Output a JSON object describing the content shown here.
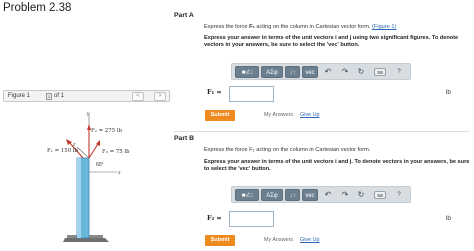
{
  "problem": {
    "title": "Problem 2.38"
  },
  "figure": {
    "label": "Figure 1",
    "current": "1",
    "of_text": "of 1",
    "prev": "<",
    "next": ">",
    "f1_label": "F₁ = 150 lb",
    "f2_label": "F₂ = 275 lb",
    "f3_label": "F₃ = 75 lb",
    "angle_label": "60°",
    "axis_x": "x",
    "axis_y": "y",
    "axis_z": "z"
  },
  "part_a": {
    "title": "Part A",
    "instruction_pre": "Express the force ",
    "force": "F₁",
    "instruction_post": " acting on the column in Cartesian vector form. ",
    "figure_link": "(Figure 1)",
    "bold_instruction": "Express your answer in terms of the unit vectors i and j using two significant figures. To denote vectors in your answers, be sure to select the 'vec' button.",
    "answer_label": "F₁ =",
    "answer_value": "",
    "unit": "lb",
    "submit": "Submit",
    "my_answers": "My Answers",
    "give_up": "Give Up"
  },
  "part_b": {
    "title": "Part B",
    "instruction": "Express the force F₂ acting on the column in Cartesian vector form.",
    "bold_instruction": "Express your answer in terms of the unit vectors i and j. To denote vectors in your answers, be sure to select the 'vec' button.",
    "answer_label": "F₂ =",
    "answer_value": "",
    "unit": "lb",
    "submit": "Submit",
    "my_answers": "My Answers",
    "give_up": "Give Up"
  },
  "toolbar": {
    "template": "■√□",
    "symbols": "AΣφ",
    "subsup": "↓↑",
    "vec": "vec",
    "keyboard": "⌨",
    "help": "?"
  }
}
